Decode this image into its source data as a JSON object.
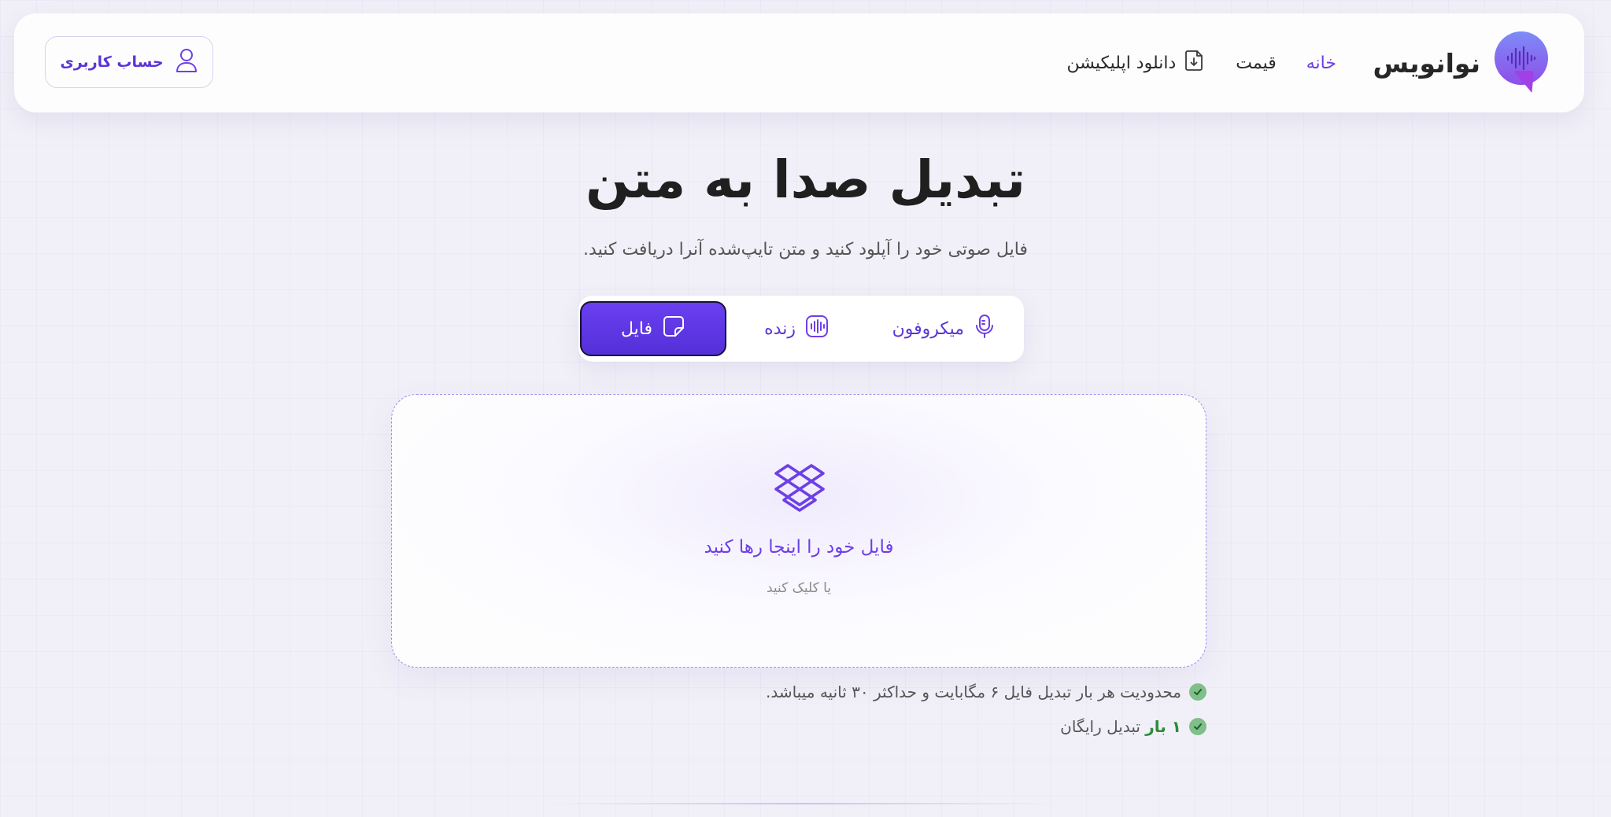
{
  "header": {
    "brand_name": "نوانویس",
    "nav": [
      {
        "label": "خانه",
        "active": true
      },
      {
        "label": "قیمت",
        "active": false
      },
      {
        "label": "دانلود اپلیکیشن",
        "icon": "download-file-icon",
        "active": false
      }
    ],
    "account_label": "حساب کاربری",
    "account_icon": "user-icon"
  },
  "hero": {
    "title": "تبدیل صدا به متن",
    "subtitle": "فایل صوتی خود را آپلود کنید و متن تایپ‌شده آنرا دریافت کنید."
  },
  "tabs": [
    {
      "label": "میکروفون",
      "icon": "microphone-icon",
      "selected": false
    },
    {
      "label": "زنده",
      "icon": "live-waveform-icon",
      "selected": false
    },
    {
      "label": "فایل",
      "icon": "file-icon",
      "selected": true
    }
  ],
  "dropzone": {
    "title": "فایل خود را اینجا رها کنید",
    "subtitle": "یا کلیک کنید",
    "icon": "dropbox-box-icon"
  },
  "notes": {
    "limit_text": "محدودیت هر بار تبدیل فایل ۶ مگابایت و حداکثر ۳۰ ثانیه میباشد.",
    "free_count": "۱ بار",
    "free_text": "تبدیل رایگان"
  },
  "colors": {
    "accent": "#6d3fe6",
    "button_gradient_top": "#6a3ff0",
    "button_gradient_bottom": "#5430d8",
    "check_green": "#7fbf8a",
    "free_count_green": "#2e8b3a",
    "background": "#f1f0f8"
  }
}
